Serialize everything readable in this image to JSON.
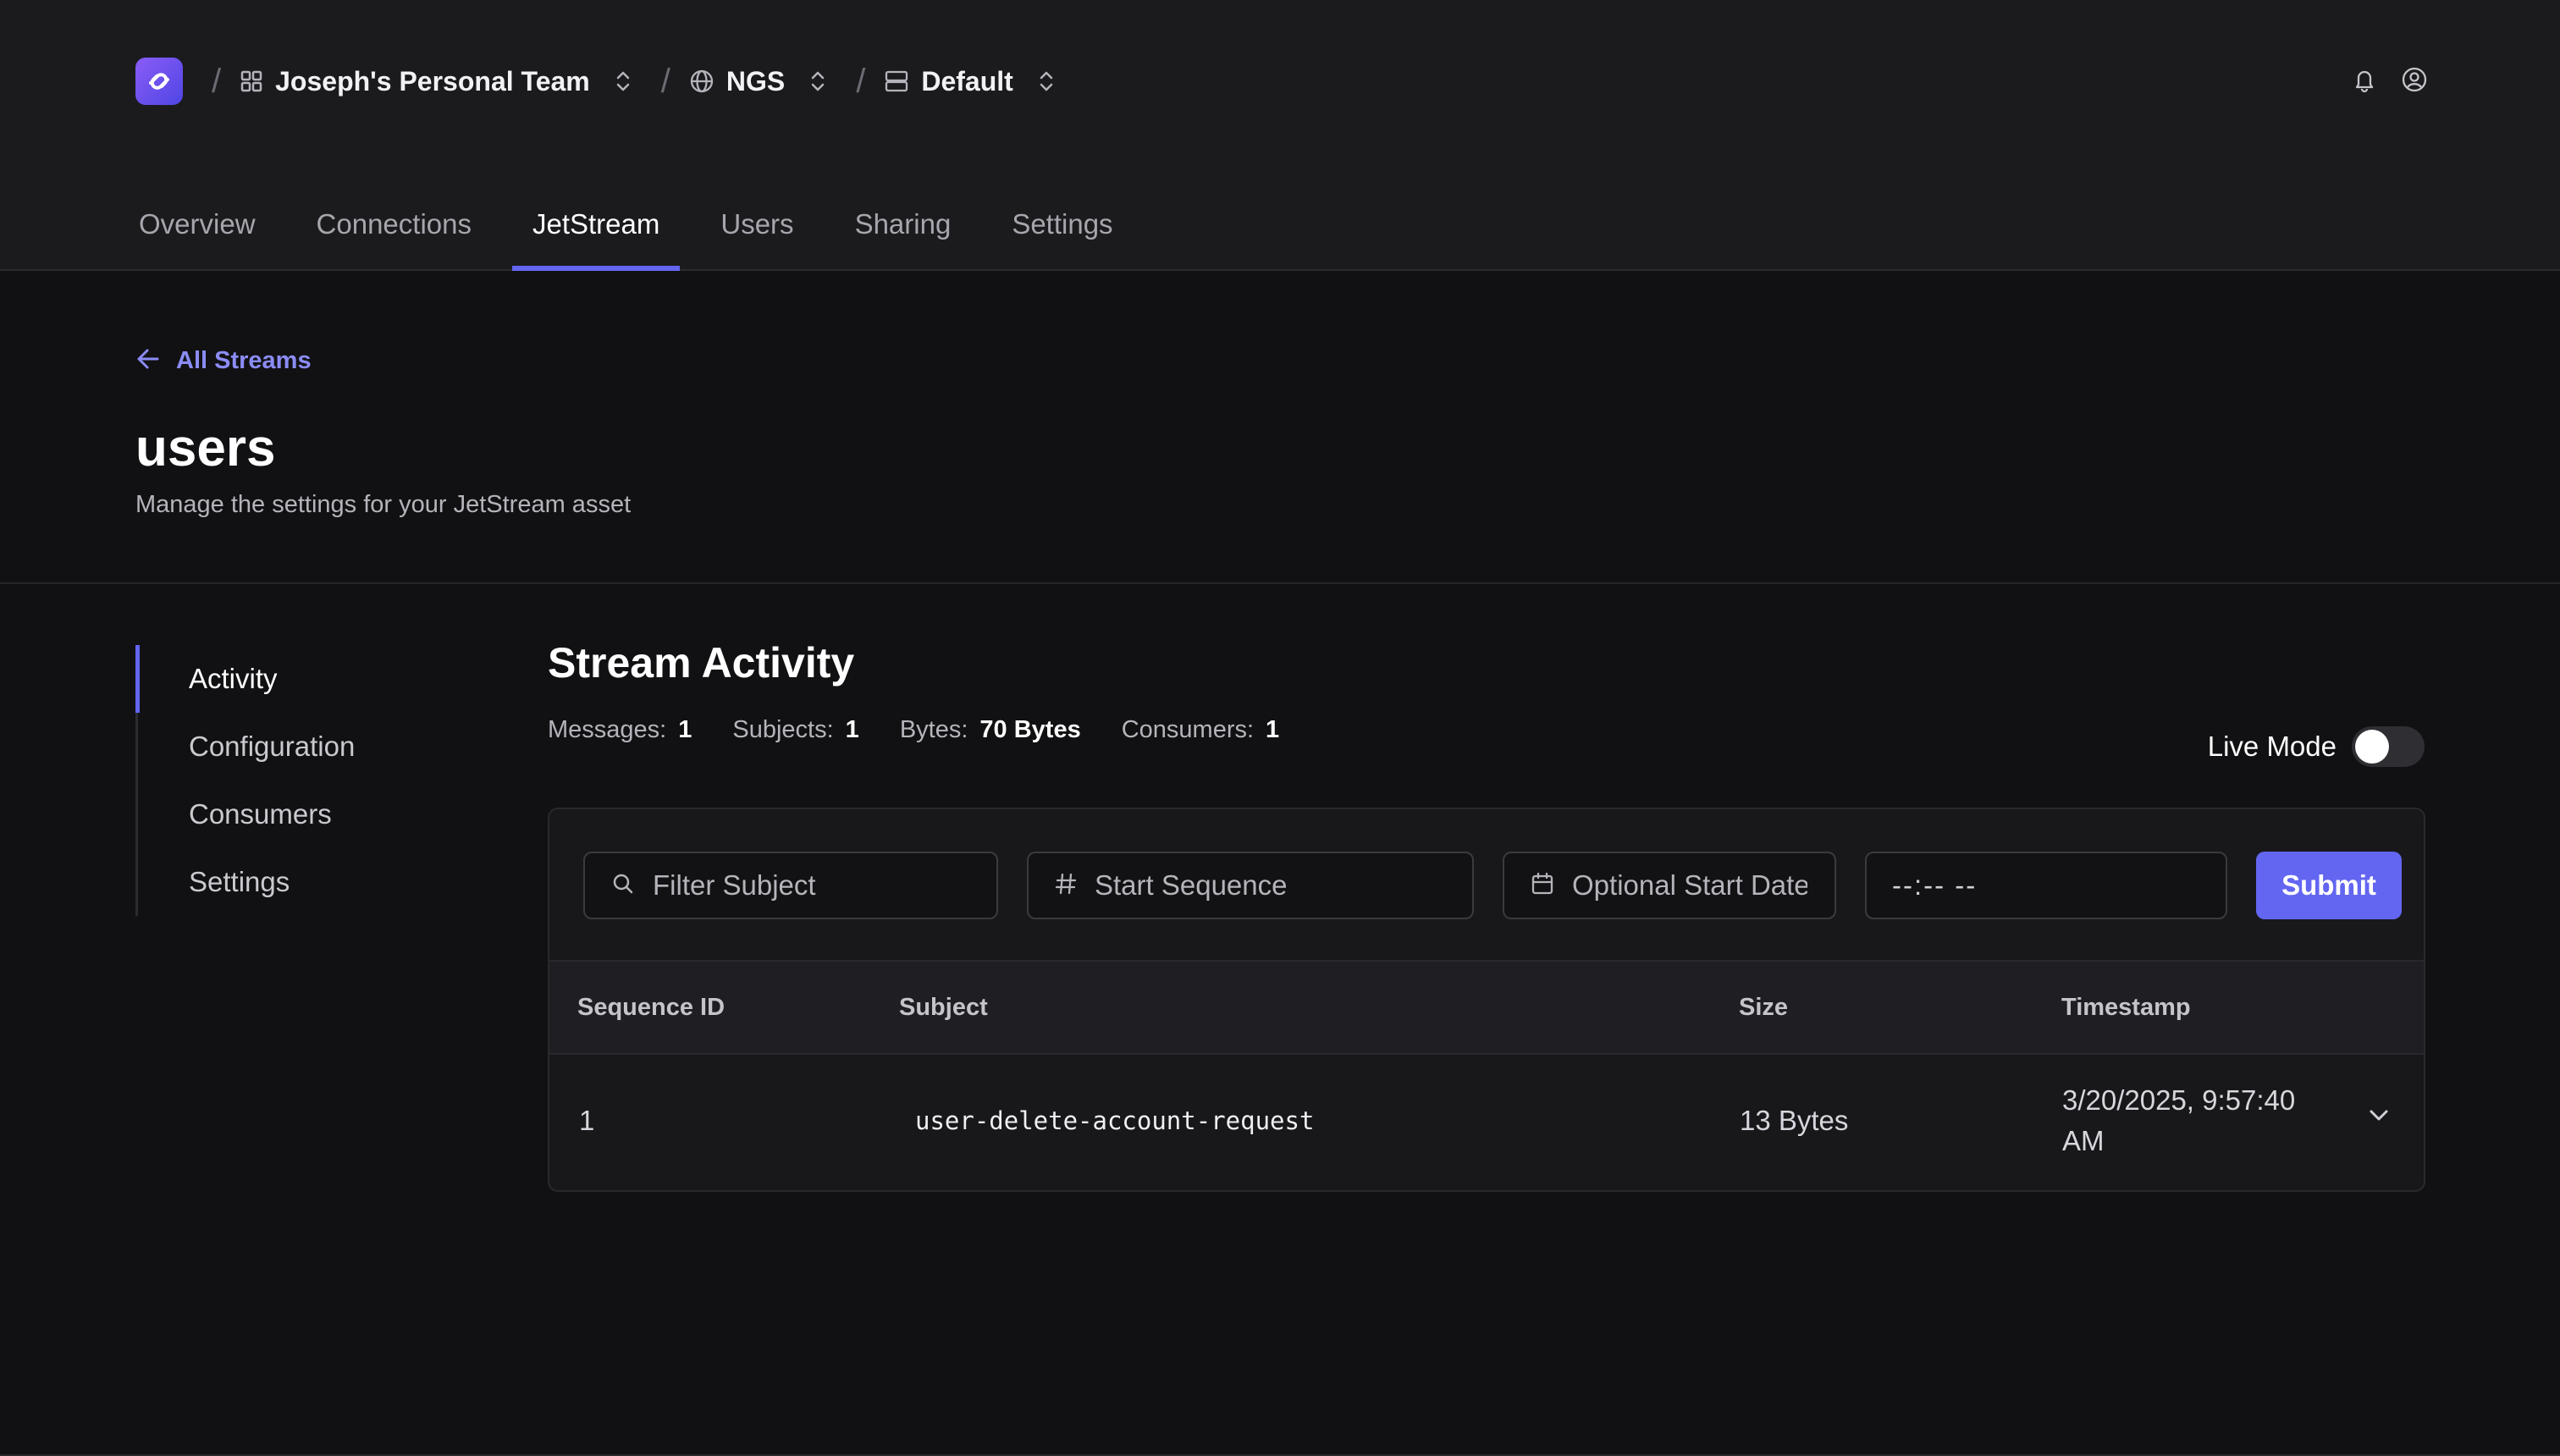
{
  "breadcrumb": {
    "team": "Joseph's Personal Team",
    "system": "NGS",
    "account": "Default",
    "separator": "/"
  },
  "tabs": [
    {
      "label": "Overview"
    },
    {
      "label": "Connections"
    },
    {
      "label": "JetStream",
      "active": true
    },
    {
      "label": "Users"
    },
    {
      "label": "Sharing"
    },
    {
      "label": "Settings"
    }
  ],
  "back_link": "All Streams",
  "page": {
    "title": "users",
    "subtitle": "Manage the settings for your JetStream asset"
  },
  "sidenav": [
    {
      "label": "Activity",
      "active": true
    },
    {
      "label": "Configuration"
    },
    {
      "label": "Consumers"
    },
    {
      "label": "Settings"
    }
  ],
  "activity": {
    "title": "Stream Activity",
    "stats": [
      {
        "label": "Messages:",
        "value": "1"
      },
      {
        "label": "Subjects:",
        "value": "1"
      },
      {
        "label": "Bytes:",
        "value": "70 Bytes"
      },
      {
        "label": "Consumers:",
        "value": "1"
      }
    ],
    "live_mode_label": "Live Mode",
    "live_mode_on": false
  },
  "filters": {
    "subject_placeholder": "Filter Subject",
    "sequence_placeholder": "Start Sequence",
    "date_placeholder": "Optional Start Date",
    "time_placeholder": "--:--  --",
    "submit_label": "Submit"
  },
  "table": {
    "columns": [
      "Sequence ID",
      "Subject",
      "Size",
      "Timestamp"
    ],
    "rows": [
      {
        "sequence": "1",
        "subject": "user-delete-account-request",
        "size": "13 Bytes",
        "timestamp": "3/20/2025, 9:57:40 AM"
      }
    ]
  },
  "colors": {
    "accent": "#6366f1",
    "background": "#111113",
    "header": "#1b1b1e"
  }
}
